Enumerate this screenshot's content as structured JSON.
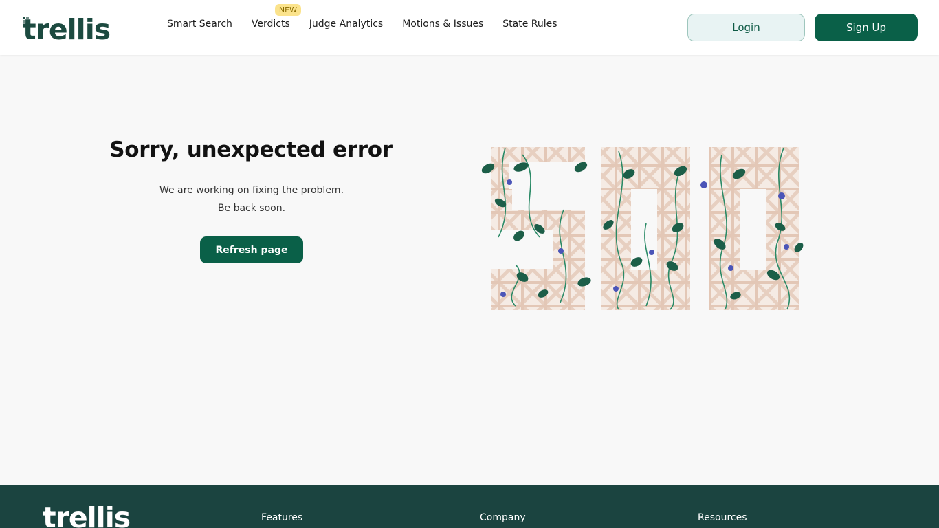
{
  "brand": {
    "name": "trellis"
  },
  "nav": {
    "items": [
      {
        "label": "Smart Search"
      },
      {
        "label": "Verdicts",
        "badge": "NEW"
      },
      {
        "label": "Judge Analytics"
      },
      {
        "label": "Motions & Issues"
      },
      {
        "label": "State Rules"
      }
    ]
  },
  "auth": {
    "login_label": "Login",
    "signup_label": "Sign Up"
  },
  "error": {
    "title": "Sorry, unexpected error",
    "description": "We are working on fixing the problem. Be back soon.",
    "refresh_label": "Refresh page"
  },
  "footer": {
    "columns": [
      "Features",
      "Company",
      "Resources"
    ]
  },
  "colors": {
    "brand_green": "#0a6048",
    "footer_bg": "#1b4440",
    "trellis_wood": "#e7cfc0",
    "leaf": "#1c5e48",
    "flower": "#4b55b8"
  },
  "icons": [
    "trellis-logo-icon",
    "error-500-trellis-illustration"
  ]
}
